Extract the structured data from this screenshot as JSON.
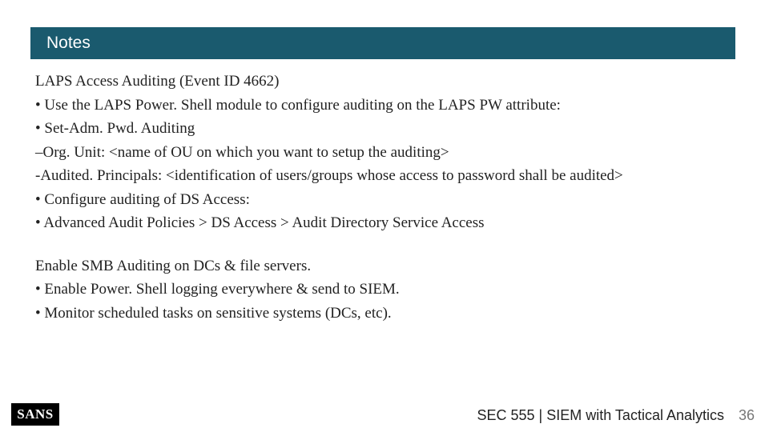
{
  "header": {
    "title": "Notes"
  },
  "body": {
    "lines": [
      "LAPS Access Auditing (Event ID 4662)",
      "• Use the LAPS Power. Shell module to configure auditing on the LAPS PW attribute:",
      "• Set-Adm. Pwd. Auditing",
      "–Org. Unit: <name of OU on which you want to setup the auditing>",
      "-Audited. Principals: <identification of users/groups whose access to password shall be audited>",
      "• Configure auditing of DS Access:",
      "• Advanced Audit Policies > DS Access > Audit Directory Service Access"
    ],
    "lines2": [
      "Enable SMB Auditing on DCs & file servers.",
      "• Enable Power. Shell logging everywhere & send to SIEM.",
      "• Monitor scheduled tasks on sensitive systems (DCs, etc)."
    ]
  },
  "footer": {
    "logo": "SANS",
    "course": "SEC 555 | SIEM with Tactical Analytics",
    "page": "36"
  }
}
